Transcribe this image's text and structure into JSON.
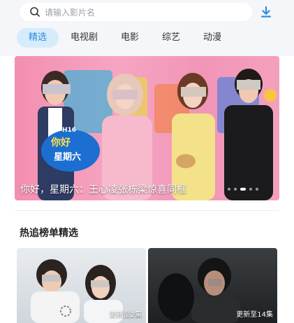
{
  "search": {
    "placeholder": "请输入影片名",
    "icon": "search-icon"
  },
  "header": {
    "download_icon": "download-icon",
    "accent": "#2e8de0"
  },
  "tabs": [
    {
      "label": "精选",
      "active": true
    },
    {
      "label": "电视剧",
      "active": false
    },
    {
      "label": "电影",
      "active": false
    },
    {
      "label": "综艺",
      "active": false
    },
    {
      "label": "动漫",
      "active": false
    }
  ],
  "banner": {
    "caption": "你好，星期六：王心凌张栋梁惊喜同框",
    "logo_text": "你好星期六",
    "logo_badge": "H16",
    "slides": 5,
    "active_slide": 3
  },
  "section": {
    "title": "热追榜单精选"
  },
  "cards": [
    {
      "badge": "更新至2集"
    },
    {
      "badge": "更新至14集"
    }
  ]
}
